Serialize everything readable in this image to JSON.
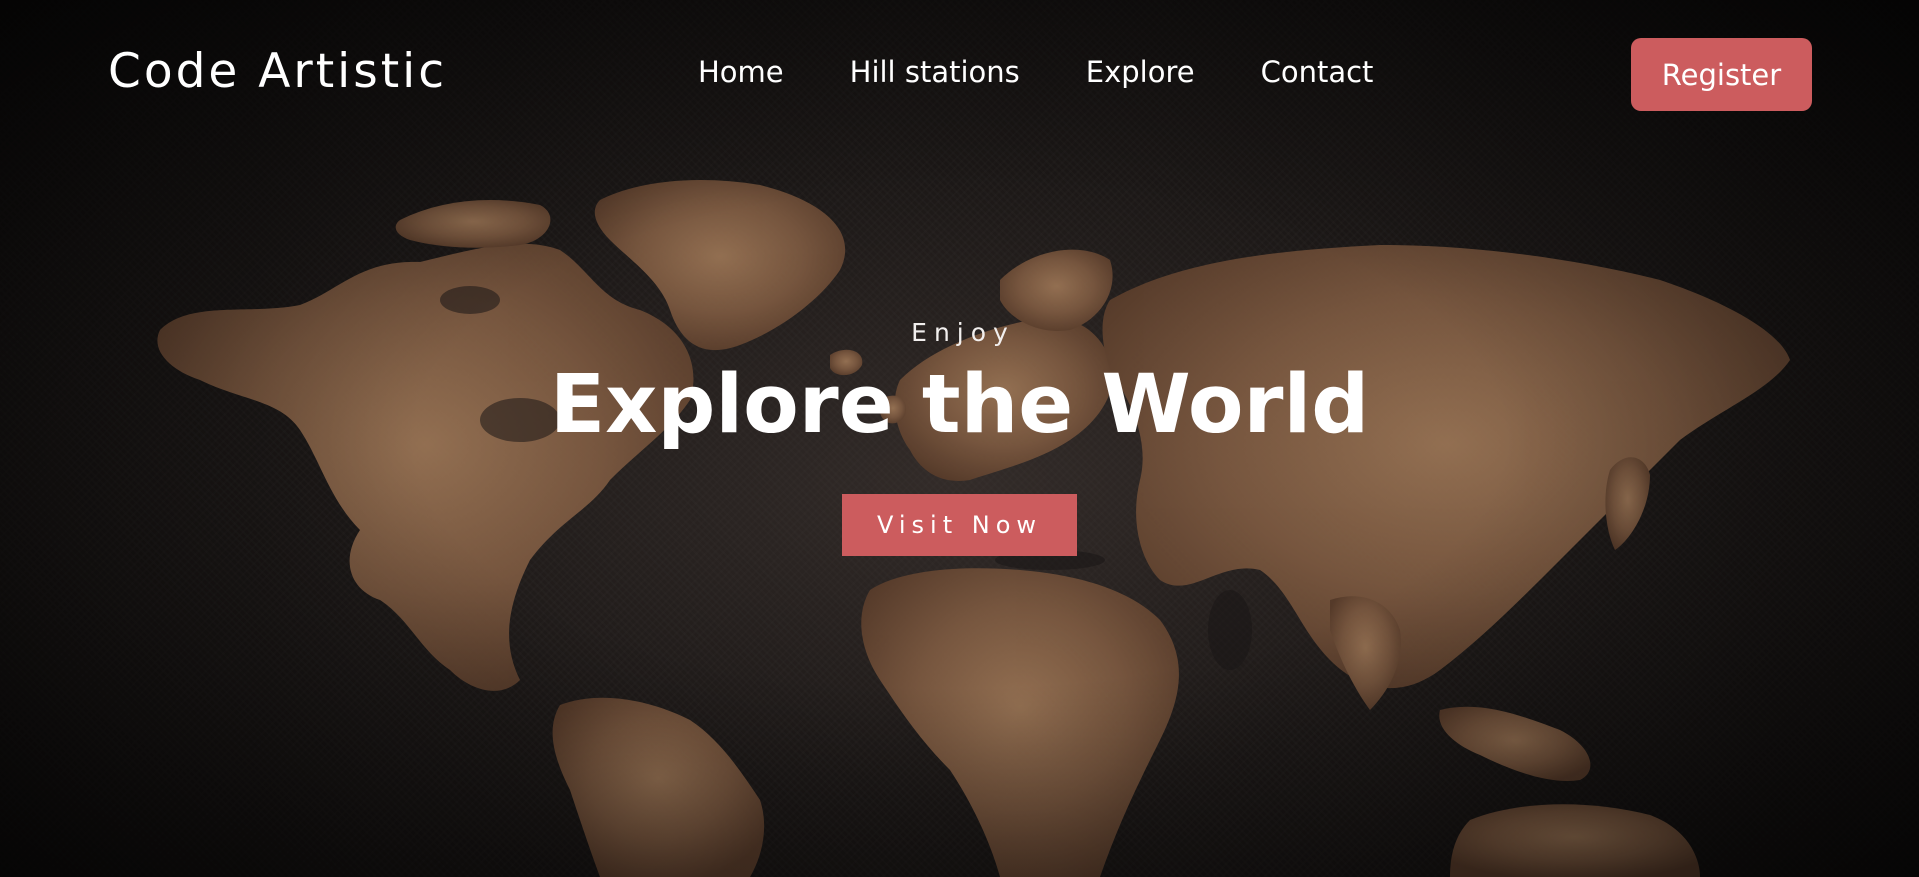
{
  "header": {
    "logo": "Code Artistic",
    "nav": [
      {
        "label": "Home"
      },
      {
        "label": "Hill stations"
      },
      {
        "label": "Explore"
      },
      {
        "label": "Contact"
      }
    ],
    "register_label": "Register"
  },
  "hero": {
    "kicker": "Enjoy",
    "title": "Explore the World",
    "cta_label": "Visit Now"
  },
  "colors": {
    "accent": "#cc5c5e",
    "background": "#1b1716",
    "map_land": "#8a6244",
    "text": "#ffffff"
  },
  "icons": {
    "background_image": "world-map-image"
  }
}
